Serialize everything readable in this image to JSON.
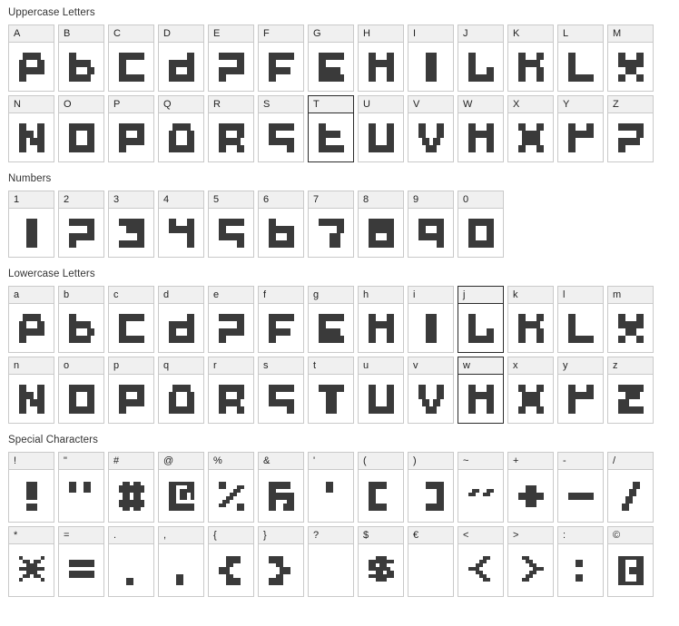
{
  "page": {
    "background": "#ffffff",
    "cell_border": "#c9c9c9",
    "cell_header_bg": "#f0f0f0",
    "glyph_color": "#3a3a3a",
    "selected_border": "#2b2b2b",
    "title_color": "#333333"
  },
  "sections": [
    {
      "id": "uppercase",
      "title": "Uppercase Letters",
      "rows": [
        [
          "A",
          "B",
          "C",
          "D",
          "E",
          "F",
          "G",
          "H",
          "I",
          "J",
          "K",
          "L",
          "M"
        ],
        [
          "N",
          "O",
          "P",
          "Q",
          "R",
          "S",
          "T",
          "U",
          "V",
          "W",
          "X",
          "Y",
          "Z"
        ]
      ]
    },
    {
      "id": "numbers",
      "title": "Numbers",
      "rows": [
        [
          "1",
          "2",
          "3",
          "4",
          "5",
          "6",
          "7",
          "8",
          "9",
          "0"
        ]
      ]
    },
    {
      "id": "lowercase",
      "title": "Lowercase Letters",
      "rows": [
        [
          "a",
          "b",
          "c",
          "d",
          "e",
          "f",
          "g",
          "h",
          "i",
          "j",
          "k",
          "l",
          "m"
        ],
        [
          "n",
          "o",
          "p",
          "q",
          "r",
          "s",
          "t",
          "u",
          "v",
          "w",
          "x",
          "y",
          "z"
        ]
      ]
    },
    {
      "id": "specials",
      "title": "Special Characters",
      "rows": [
        [
          "!",
          "\"",
          "#",
          "@",
          "%",
          "&",
          "'",
          "(",
          ")",
          "~",
          "+",
          "-",
          "/"
        ],
        [
          "*",
          "=",
          ".",
          ",",
          "{",
          "}",
          "?",
          "$",
          "€",
          "<",
          ">",
          ":",
          "©"
        ]
      ]
    }
  ],
  "selected_cells": [
    "uppercase:T",
    "lowercase:j",
    "lowercase:w"
  ],
  "glyph_pixels": {
    "A": [
      "0111110",
      "0111110",
      "1100011",
      "1100011",
      "1111111",
      "1111111",
      "1100000",
      "1100000"
    ],
    "B": [
      "1100000",
      "1100000",
      "1111110",
      "1111110",
      "1100011",
      "1100011",
      "1111110",
      "1111110"
    ],
    "C": [
      "1111111",
      "1111111",
      "1100000",
      "1100000",
      "1100000",
      "1100000",
      "1111111",
      "1111111"
    ],
    "D": [
      "0000011",
      "0000011",
      "1111111",
      "1111111",
      "1100011",
      "1100011",
      "1111111",
      "1111111"
    ],
    "E": [
      "1111111",
      "1111111",
      "0000011",
      "0000011",
      "1111111",
      "1111111",
      "1100000",
      "1100000"
    ],
    "F": [
      "1111111",
      "1111111",
      "1100000",
      "1100000",
      "1111110",
      "1111110",
      "1100000",
      "1100000"
    ],
    "G": [
      "1111111",
      "1111111",
      "1100000",
      "1100000",
      "1111110",
      "1111110",
      "1111111",
      "1111111"
    ],
    "H": [
      "1100011",
      "1100011",
      "1111111",
      "1111111",
      "1100011",
      "1100011",
      "1100011",
      "1100011"
    ],
    "I": [
      "0011100",
      "0011100",
      "0011100",
      "0011100",
      "0011100",
      "0011100",
      "0011100",
      "0011100"
    ],
    "J": [
      "1100000",
      "1100000",
      "1100000",
      "1100000",
      "1100011",
      "1100011",
      "1111111",
      "1111111"
    ],
    "K": [
      "1100011",
      "1100011",
      "1111110",
      "1111110",
      "1100011",
      "1100011",
      "1100011",
      "1100011"
    ],
    "L": [
      "1100000",
      "1100000",
      "1100000",
      "1100000",
      "1100000",
      "1100000",
      "1111111",
      "1111111"
    ],
    "M": [
      "1100011",
      "1100011",
      "1111111",
      "1111111",
      "0011100",
      "0011100",
      "1100011",
      "1100011"
    ],
    "N": [
      "1100011",
      "1100011",
      "1111011",
      "1111011",
      "1101111",
      "1101111",
      "1100011",
      "1100011"
    ],
    "O": [
      "1111111",
      "1111111",
      "1100011",
      "1100011",
      "1100011",
      "1100011",
      "1111111",
      "1111111"
    ],
    "P": [
      "1111111",
      "1111111",
      "1100011",
      "1100011",
      "1111111",
      "1111111",
      "1100000",
      "1100000"
    ],
    "Q": [
      "0111110",
      "0111110",
      "1100011",
      "1100011",
      "1100011",
      "1100011",
      "1111111",
      "1111111"
    ],
    "R": [
      "1111111",
      "1111111",
      "1100011",
      "1100011",
      "1111110",
      "1111110",
      "1100011",
      "1100011"
    ],
    "S": [
      "1111111",
      "1111111",
      "1100000",
      "1100000",
      "1111111",
      "1111111",
      "0000011",
      "0000011"
    ],
    "T": [
      "1100000",
      "1100000",
      "1111110",
      "1111110",
      "1100000",
      "1100000",
      "1111111",
      "1111111"
    ],
    "U": [
      "1100011",
      "1100011",
      "1100011",
      "1100011",
      "1100011",
      "1100011",
      "1111111",
      "1111111"
    ],
    "V": [
      "1100011",
      "1100011",
      "1100011",
      "1100011",
      "0110110",
      "0110110",
      "0011100",
      "0011100"
    ],
    "W": [
      "1100011",
      "1100011",
      "1111111",
      "1111111",
      "1100011",
      "1100011",
      "1100011",
      "1100011"
    ],
    "X": [
      "1100011",
      "1100011",
      "0111110",
      "0111110",
      "0111110",
      "0111110",
      "1100011",
      "1100011"
    ],
    "Y": [
      "1100011",
      "1100011",
      "1111111",
      "1111111",
      "1100000",
      "1100000",
      "1100000",
      "1100000"
    ],
    "Z": [
      "1111111",
      "1111111",
      "0000011",
      "0000011",
      "1111110",
      "1111110",
      "1100000",
      "1100000"
    ],
    "z": [
      "1111111",
      "1111111",
      "0011110",
      "0011110",
      "1110000",
      "1110000",
      "1111111",
      "1111111"
    ],
    "t": [
      "1111111",
      "1111111",
      "0011100",
      "0011100",
      "0011100",
      "0011100",
      "0011100",
      "0011100"
    ],
    "1": [
      "0011100",
      "0011100",
      "0011100",
      "0011100",
      "0011100",
      "0011100",
      "0011100",
      "0011100"
    ],
    "2": [
      "1111111",
      "1111111",
      "0000011",
      "0000011",
      "1111111",
      "1111111",
      "1100000",
      "1100000"
    ],
    "3": [
      "1111111",
      "1111111",
      "0011111",
      "0011111",
      "0000011",
      "0000011",
      "1111111",
      "1111111"
    ],
    "4": [
      "1100011",
      "1100011",
      "1111111",
      "1111111",
      "0000011",
      "0000011",
      "0000011",
      "0000011"
    ],
    "5": [
      "1111111",
      "1111111",
      "1100000",
      "1100000",
      "1111111",
      "1111111",
      "0000011",
      "0000011"
    ],
    "6": [
      "1100000",
      "1100000",
      "1111111",
      "1111111",
      "1100011",
      "1100011",
      "1111111",
      "1111111"
    ],
    "7": [
      "1111111",
      "1111111",
      "0000011",
      "0000011",
      "0001110",
      "0001110",
      "0001110",
      "0001110"
    ],
    "8": [
      "1111111",
      "1111111",
      "1111111",
      "1111111",
      "1100011",
      "1100011",
      "1111111",
      "1111111"
    ],
    "9": [
      "1111111",
      "1111111",
      "1100011",
      "1100011",
      "1111111",
      "1111111",
      "0000011",
      "0000011"
    ],
    "0": [
      "1111111",
      "1111111",
      "1100011",
      "1100011",
      "1100011",
      "1100011",
      "1111111",
      "1111111"
    ],
    "!": [
      "0011100",
      "0011100",
      "0011100",
      "0011100",
      "0011100",
      "0000000",
      "0011100",
      "0011100"
    ],
    "\"": [
      "1100110",
      "1100110",
      "1100110",
      "0000000",
      "0000000",
      "0000000",
      "0000000",
      "0000000"
    ],
    "#": [
      "0110110",
      "1111111",
      "1111111",
      "0110110",
      "0110110",
      "1111111",
      "1111111",
      "0110110"
    ],
    "@": [
      "1111111",
      "1100011",
      "1101111",
      "1101101",
      "1101101",
      "1100000",
      "1111111",
      "1111111"
    ],
    "%": [
      "1100000",
      "1100011",
      "0000110",
      "0001100",
      "0011000",
      "0110000",
      "1100011",
      "0000011"
    ],
    "&": [
      "1111110",
      "1111110",
      "1100000",
      "1111111",
      "1111111",
      "1100011",
      "1100111",
      "1100111"
    ],
    "'": [
      "0011000",
      "0011000",
      "0011000",
      "0000000",
      "0000000",
      "0000000",
      "0000000",
      "0000000"
    ],
    "(": [
      "1111100",
      "1111100",
      "1100000",
      "1100000",
      "1100000",
      "1100000",
      "1111100",
      "1111100"
    ],
    ")": [
      "0011111",
      "0011111",
      "0000011",
      "0000011",
      "0000011",
      "0000011",
      "0011111",
      "0011111"
    ],
    "~": [
      "0000000",
      "0000000",
      "0110011",
      "1100110",
      "0000000",
      "0000000",
      "0000000",
      "0000000"
    ],
    "+": [
      "0000000",
      "0011100",
      "0011100",
      "1111111",
      "1111111",
      "0011100",
      "0011100",
      "0000000"
    ],
    "-": [
      "0000000",
      "0000000",
      "0000000",
      "1111111",
      "1111111",
      "0000000",
      "0000000",
      "0000000"
    ],
    "/": [
      "0000110",
      "0000110",
      "0001100",
      "0001100",
      "0011000",
      "0011000",
      "0110000",
      "0110000"
    ],
    "*": [
      "1000001",
      "0110110",
      "0011100",
      "1111111",
      "0011100",
      "0110110",
      "1000001",
      "0000000"
    ],
    "=": [
      "0000000",
      "1111111",
      "1111111",
      "0000000",
      "1111111",
      "1111111",
      "0000000",
      "0000000"
    ],
    ".": [
      "0000000",
      "0000000",
      "0000000",
      "0000000",
      "0000000",
      "0000000",
      "0011000",
      "0011000"
    ],
    ",": [
      "0000000",
      "0000000",
      "0000000",
      "0000000",
      "0000000",
      "0011000",
      "0011000",
      "0011000"
    ],
    "{": [
      "0011110",
      "0011110",
      "0011000",
      "1110000",
      "1110000",
      "0011000",
      "0011110",
      "0011110"
    ],
    "}": [
      "1111000",
      "1111000",
      "0011000",
      "0001110",
      "0001110",
      "0011000",
      "1111000",
      "1111000"
    ],
    "?": [
      "0000000",
      "0000000",
      "0000000",
      "0000000",
      "0000000",
      "0000000",
      "0000000",
      "0000000"
    ],
    "$": [
      "0011100",
      "1111111",
      "1101100",
      "1111110",
      "0011011",
      "1111111",
      "0011100",
      "0000000"
    ],
    "€": [
      "0000000",
      "0000000",
      "0000000",
      "0000000",
      "0000000",
      "0000000",
      "0000000",
      "0000000"
    ],
    "<": [
      "0000110",
      "0001100",
      "0011000",
      "1110000",
      "0011000",
      "0001100",
      "0000110",
      "0000000"
    ],
    ">": [
      "0110000",
      "0011000",
      "0001100",
      "0000111",
      "0001100",
      "0011000",
      "0110000",
      "0000000"
    ],
    ":": [
      "0000000",
      "0011000",
      "0011000",
      "0000000",
      "0000000",
      "0011000",
      "0011000",
      "0000000"
    ],
    "©": [
      "1111111",
      "1100011",
      "1100011",
      "1101111",
      "1101111",
      "1100011",
      "1100011",
      "1111111"
    ]
  }
}
